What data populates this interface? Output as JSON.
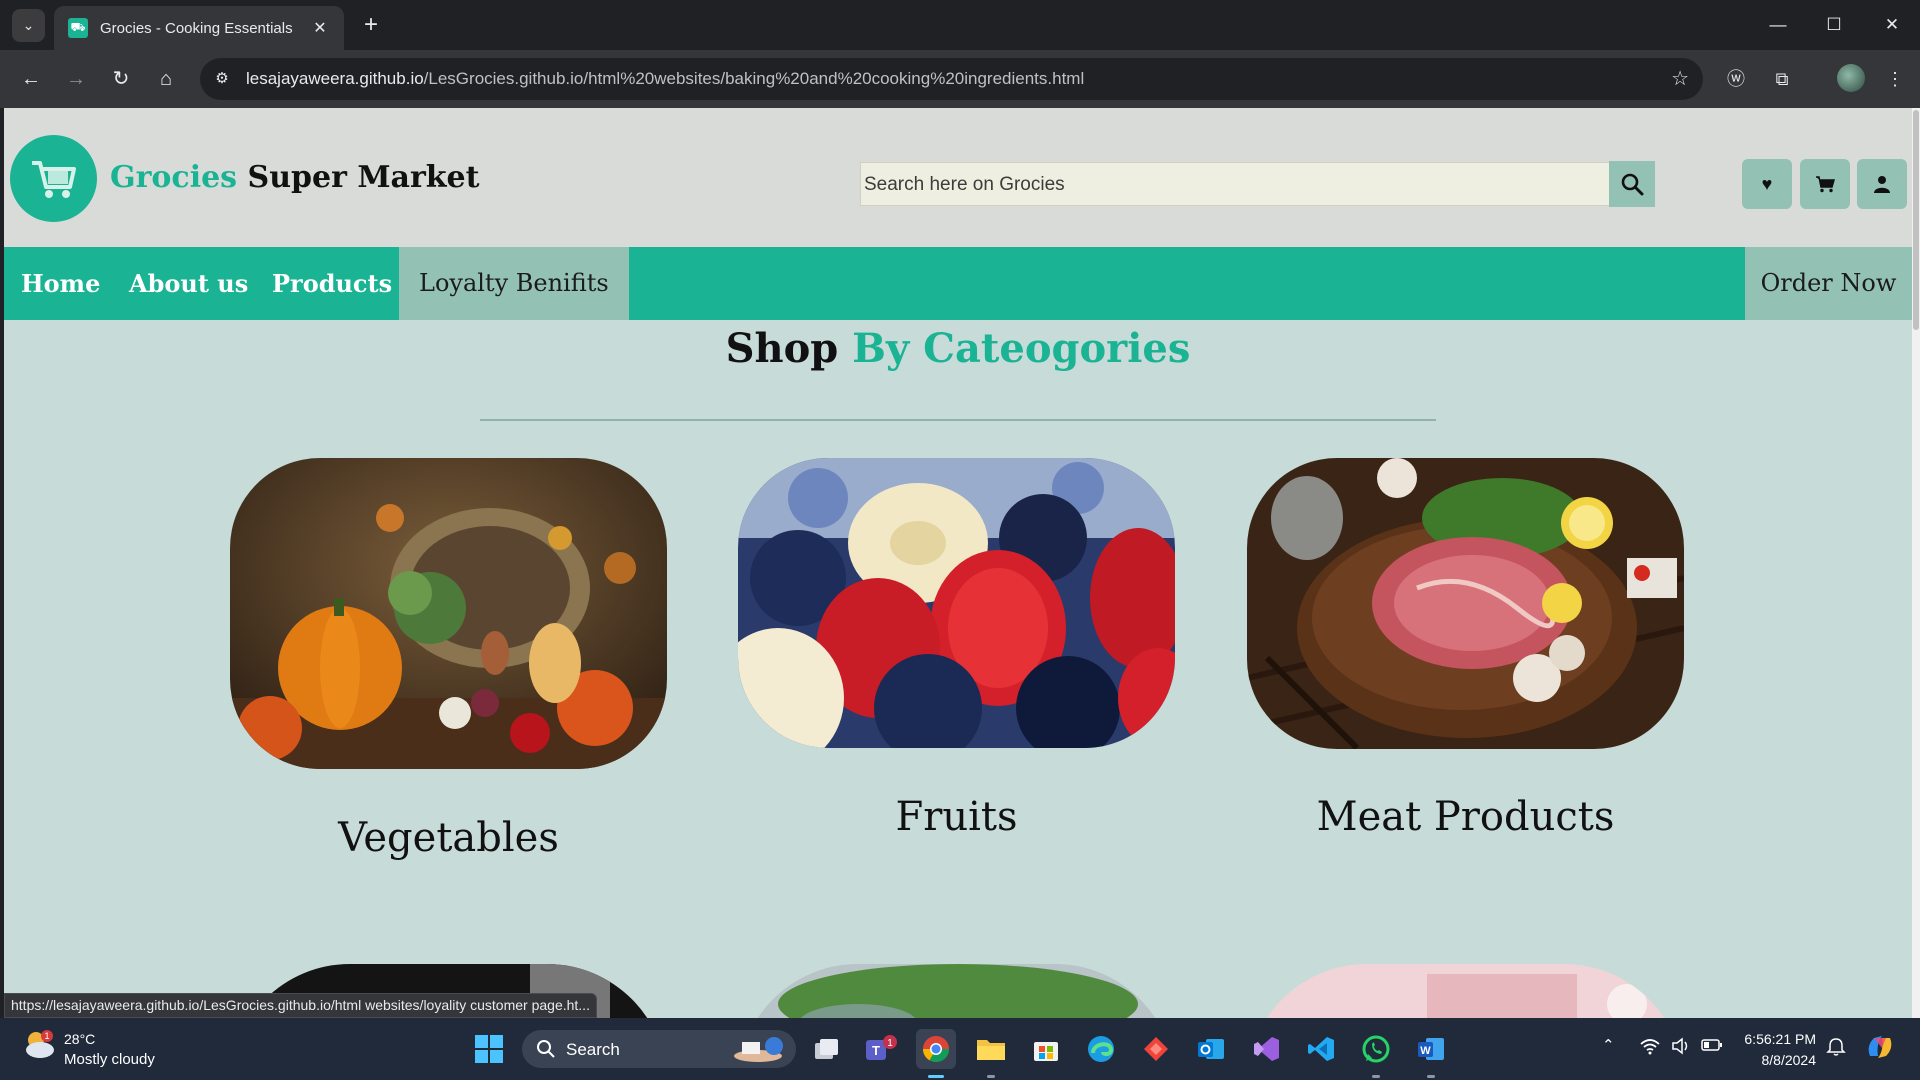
{
  "browser": {
    "tab_title": "Grocies - Cooking Essentials",
    "url_host": "lesajayaweera.github.io",
    "url_path": "/LesGrocies.github.io/html%20websites/baking%20and%20cooking%20ingredients.html",
    "status_url": "https://lesajayaweera.github.io/LesGrocies.github.io/html websites/loyality customer page.ht..."
  },
  "header": {
    "brand_accent": "Grocies",
    "brand_rest": "Super Market",
    "search_placeholder": "Search here on Grocies"
  },
  "nav": {
    "items": [
      {
        "label": "Home"
      },
      {
        "label": "About us"
      },
      {
        "label": "Products"
      },
      {
        "label": "Loyalty Benifits"
      }
    ],
    "order_label": "Order Now"
  },
  "section": {
    "title_plain": "Shop",
    "title_accent": "By Cateogories"
  },
  "categories": [
    {
      "label": "Vegetables"
    },
    {
      "label": "Fruits"
    },
    {
      "label": "Meat Products"
    }
  ],
  "taskbar": {
    "weather_temp": "28°C",
    "weather_cond": "Mostly cloudy",
    "weather_badge": "1",
    "search_label": "Search",
    "teams_badge": "1",
    "time": "6:56:21 PM",
    "date": "8/8/2024"
  },
  "colors": {
    "brand_green": "#1ab394",
    "nav_active": "#93c2b5",
    "page_bg": "#c7dbd8"
  }
}
